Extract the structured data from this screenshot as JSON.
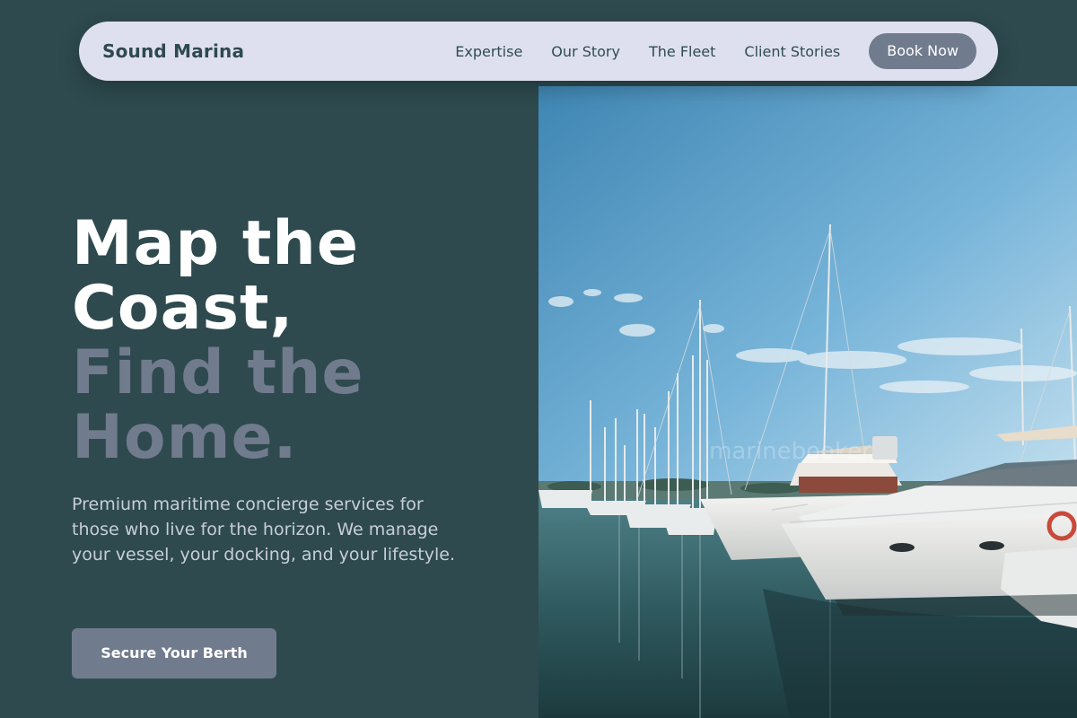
{
  "navbar": {
    "brand": "Sound Marina",
    "links": [
      "Expertise",
      "Our Story",
      "The Fleet",
      "Client Stories"
    ],
    "cta": "Book Now"
  },
  "hero": {
    "title_lines": [
      "Map the",
      "Coast,",
      "Find the",
      "Home."
    ],
    "description": "Premium maritime concierge services for those who live for the horizon. We manage your vessel, your docking, and your lifestyle.",
    "cta": "Secure Your Berth"
  },
  "image": {
    "subject": "marina with sailboats and yachts at dock"
  },
  "colors": {
    "background": "#2e4a4f",
    "navbar": "#dfe0ef",
    "accent": "#717b8e",
    "heading": "#ffffff",
    "body_text": "#c7ced8"
  }
}
